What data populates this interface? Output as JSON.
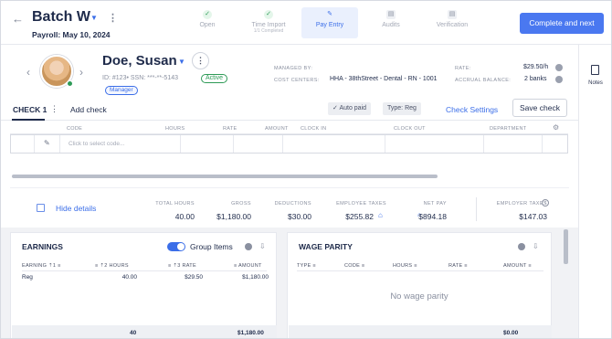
{
  "header": {
    "batch_title": "Batch W",
    "payroll_date": "Payroll: May 10, 2024",
    "complete_label": "Complete and next",
    "steps": [
      {
        "label": "Open",
        "sub": "",
        "state": "done"
      },
      {
        "label": "Time Import",
        "sub": "1/1 Completed",
        "state": "done"
      },
      {
        "label": "Pay Entry",
        "sub": "",
        "state": "active"
      },
      {
        "label": "Audits",
        "sub": "",
        "state": "todo"
      },
      {
        "label": "Verification",
        "sub": "",
        "state": "todo"
      }
    ]
  },
  "rail": {
    "notes_label": "Notes"
  },
  "employee": {
    "name": "Doe, Susan",
    "ids": "ID: #123• SSN: ***-**-5143",
    "status": "Active",
    "role": "Manager",
    "managed_by_label": "MANAGED BY:",
    "managed_by_value": "",
    "cost_centers_label": "COST CENTERS:",
    "cost_centers_value": "HHA - 38thStreet - Dental - RN - 1001",
    "rate_label": "RATE:",
    "rate_value": "$29.50/h",
    "accrual_label": "ACCRUAL BALANCE:",
    "accrual_value": "2 banks"
  },
  "checks": {
    "tab_label": "CHECK 1",
    "add_check": "Add check",
    "auto_paid": "Auto paid",
    "type": "Type: Reg",
    "settings": "Check Settings",
    "save": "Save check"
  },
  "grid": {
    "headers": [
      "CODE",
      "HOURS",
      "RATE",
      "AMOUNT",
      "CLOCK IN",
      "CLOCK OUT",
      "DEPARTMENT"
    ],
    "code_placeholder": "Click to select code..."
  },
  "totals": {
    "hide_details": "Hide details",
    "items": [
      {
        "label": "TOTAL HOURS",
        "value": "40.00"
      },
      {
        "label": "GROSS",
        "value": "$1,180.00"
      },
      {
        "label": "DEDUCTIONS",
        "value": "$30.00"
      },
      {
        "label": "EMPLOYEE TAXES",
        "value": "$255.82"
      },
      {
        "label": "NET PAY",
        "value": "$894.18"
      },
      {
        "label": "EMPLOYER TAXES",
        "value": "$147.03"
      }
    ]
  },
  "earnings": {
    "title": "EARNINGS",
    "group_items": "Group Items",
    "group_items_on": true,
    "headers": [
      "EARNING",
      "HOURS",
      "RATE",
      "AMOUNT"
    ],
    "rows": [
      {
        "earning": "Reg",
        "hours": "40.00",
        "rate": "$29.50",
        "amount": "$1,180.00"
      }
    ],
    "footer_hours": "40",
    "footer_amount": "$1,180.00"
  },
  "wage_parity": {
    "title": "WAGE PARITY",
    "headers": [
      "TYPE",
      "CODE",
      "HOURS",
      "RATE",
      "AMOUNT"
    ],
    "empty_text": "No wage parity",
    "footer_amount": "$0.00"
  },
  "colors": {
    "accent": "#4a78f0",
    "success": "#2e9b57",
    "text": "#1e2a4a"
  }
}
